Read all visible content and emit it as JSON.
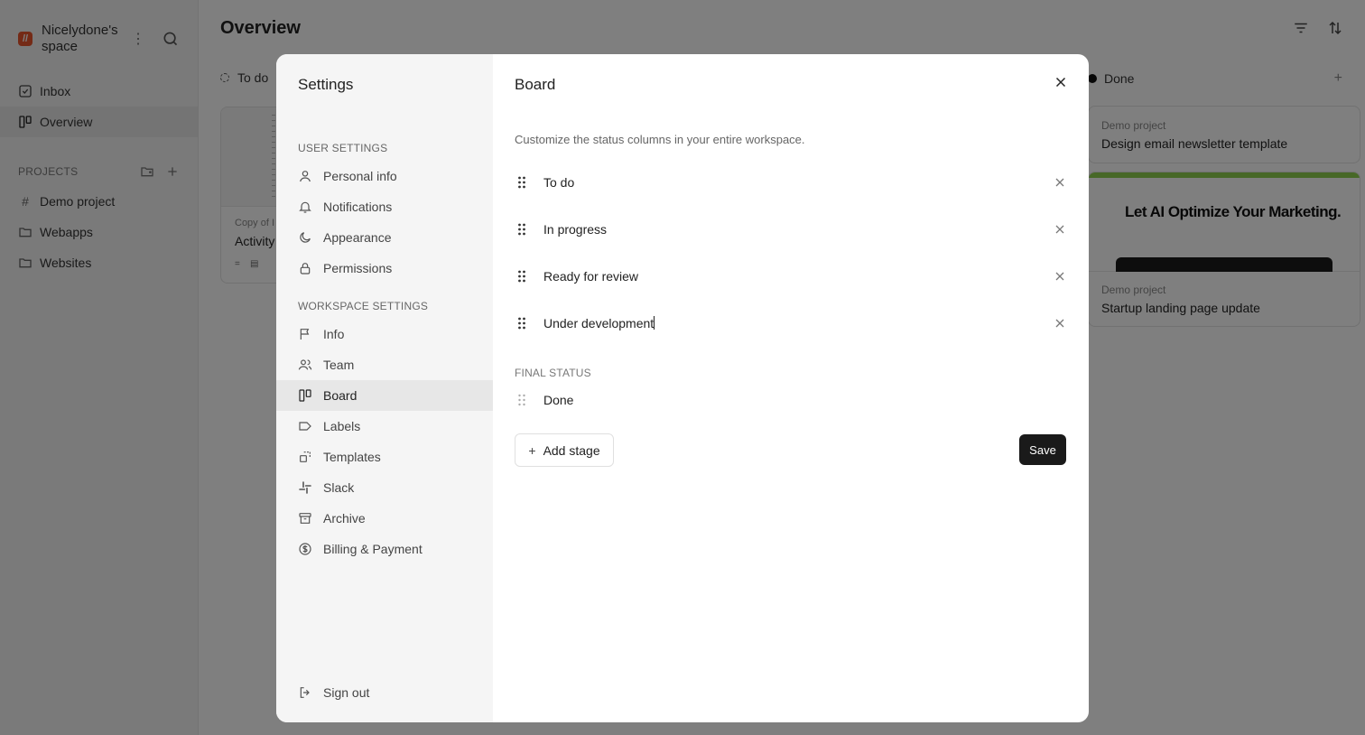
{
  "workspace": {
    "name": "Nicelydone's space",
    "logo_glyph": "//"
  },
  "sidebar": {
    "nav": [
      {
        "label": "Inbox"
      },
      {
        "label": "Overview"
      }
    ],
    "projects_label": "PROJECTS",
    "projects": [
      {
        "label": "Demo project"
      },
      {
        "label": "Webapps"
      },
      {
        "label": "Websites"
      }
    ]
  },
  "main": {
    "title": "Overview",
    "todo_column": "To do",
    "todo_card": {
      "project": "Copy of I",
      "title": "Activity"
    },
    "done_column": "Done",
    "done_cards": [
      {
        "project": "Demo project",
        "title": "Design email newsletter template"
      },
      {
        "project": "Demo project",
        "title": "Startup landing page update",
        "thumbnail_headline": "Let AI Optimize Your Marketing."
      }
    ]
  },
  "settings": {
    "title": "Settings",
    "user_section": "USER SETTINGS",
    "user_items": [
      {
        "label": "Personal info",
        "icon": "user-icon"
      },
      {
        "label": "Notifications",
        "icon": "bell-icon"
      },
      {
        "label": "Appearance",
        "icon": "moon-icon"
      },
      {
        "label": "Permissions",
        "icon": "lock-icon"
      }
    ],
    "workspace_section": "WORKSPACE SETTINGS",
    "workspace_items": [
      {
        "label": "Info",
        "icon": "flag-icon"
      },
      {
        "label": "Team",
        "icon": "users-icon"
      },
      {
        "label": "Board",
        "icon": "board-icon"
      },
      {
        "label": "Labels",
        "icon": "tag-icon"
      },
      {
        "label": "Templates",
        "icon": "templates-icon"
      },
      {
        "label": "Slack",
        "icon": "slack-icon"
      },
      {
        "label": "Archive",
        "icon": "archive-icon"
      },
      {
        "label": "Billing & Payment",
        "icon": "dollar-icon"
      }
    ],
    "sign_out": "Sign out"
  },
  "board": {
    "title": "Board",
    "description": "Customize the status columns in your entire workspace.",
    "stages": [
      {
        "name": "To do"
      },
      {
        "name": "In progress"
      },
      {
        "name": "Ready for review"
      },
      {
        "name": "Under development"
      }
    ],
    "final_status_label": "FINAL STATUS",
    "final_status": "Done",
    "add_stage": "Add stage",
    "save": "Save"
  },
  "colors": {
    "accent_brand": "#e8542c",
    "primary_button": "#1a1a1a",
    "overlay": "rgba(0,0,0,0.5)"
  }
}
